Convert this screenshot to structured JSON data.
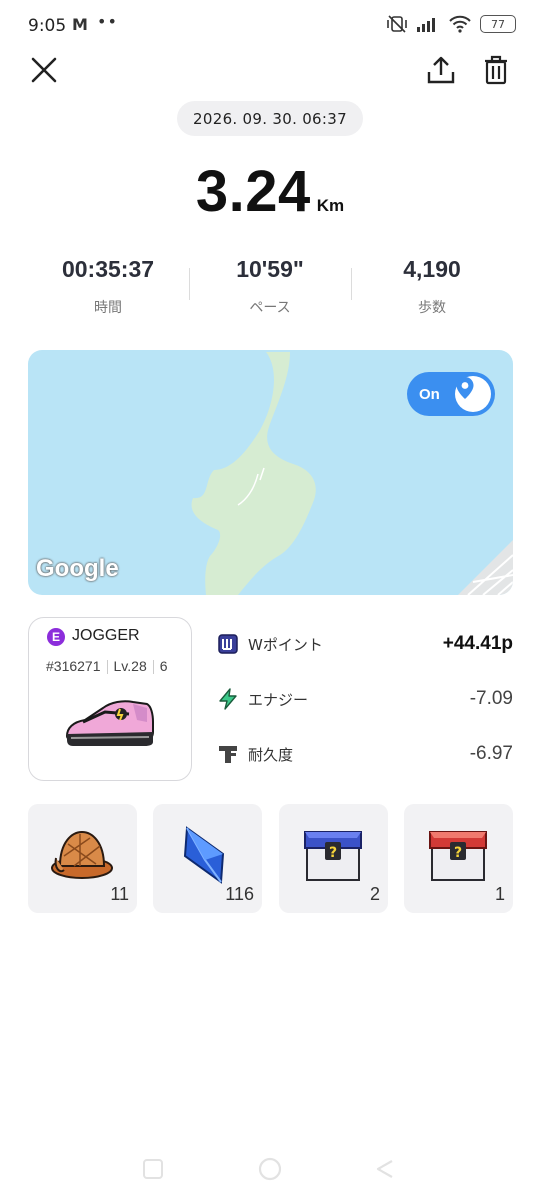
{
  "status_bar": {
    "time": "9:05",
    "mail_icon": "M",
    "dots": "••",
    "battery": "77"
  },
  "header": {
    "close_icon": "close-icon",
    "share_icon": "share-icon",
    "delete_icon": "trash-icon"
  },
  "record": {
    "datetime": "2026. 09. 30. 06:37",
    "distance": "3.24",
    "distance_unit": "Km",
    "stats": [
      {
        "value": "00:35:37",
        "label": "時間"
      },
      {
        "value": "10'59\"",
        "label": "ペース"
      },
      {
        "value": "4,190",
        "label": "歩数"
      }
    ]
  },
  "map": {
    "toggle_label": "On",
    "attribution": "Google"
  },
  "sneaker": {
    "type_badge": "E",
    "type": "JOGGER",
    "id": "#316271",
    "level": "Lv.28",
    "extra_icon": "6"
  },
  "rewards": [
    {
      "icon": "wpoint-icon",
      "label": "Wポイント",
      "value": "+44.41p"
    },
    {
      "icon": "energy-icon",
      "label": "エナジー",
      "value": "-7.09"
    },
    {
      "icon": "durability-icon",
      "label": "耐久度",
      "value": "-6.97"
    }
  ],
  "items": [
    {
      "icon": "detective-hat-icon",
      "count": "11"
    },
    {
      "icon": "blue-gem-icon",
      "count": "116"
    },
    {
      "icon": "blue-mystery-box-icon",
      "count": "2"
    },
    {
      "icon": "red-mystery-box-icon",
      "count": "1"
    }
  ],
  "colors": {
    "accent": "#3b8ff0",
    "badge": "#8c2ddb",
    "map_water": "#b9e4f6",
    "map_land": "#d6ecd2"
  }
}
